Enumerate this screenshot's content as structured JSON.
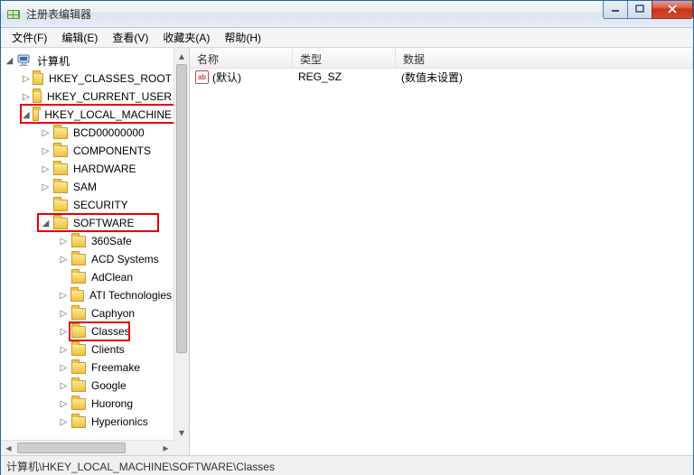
{
  "window": {
    "title": "注册表编辑器"
  },
  "menu": {
    "file": "文件(F)",
    "edit": "编辑(E)",
    "view": "查看(V)",
    "favorites": "收藏夹(A)",
    "help": "帮助(H)"
  },
  "tree": {
    "root": "计算机",
    "hkcr": "HKEY_CLASSES_ROOT",
    "hkcu": "HKEY_CURRENT_USER",
    "hklm": "HKEY_LOCAL_MACHINE",
    "hklm_children": {
      "bcd": "BCD00000000",
      "components": "COMPONENTS",
      "hardware": "HARDWARE",
      "sam": "SAM",
      "security": "SECURITY",
      "software": "SOFTWARE"
    },
    "software_children": {
      "s360": "360Safe",
      "acd": "ACD Systems",
      "adclean": "AdClean",
      "ati": "ATI Technologies",
      "caphyon": "Caphyon",
      "classes": "Classes",
      "clients": "Clients",
      "freemake": "Freemake",
      "google": "Google",
      "huorong": "Huorong",
      "hyperionics": "Hyperionics"
    }
  },
  "list": {
    "columns": {
      "name": "名称",
      "type": "类型",
      "data": "数据"
    },
    "rows": [
      {
        "name": "(默认)",
        "type": "REG_SZ",
        "data": "(数值未设置)"
      }
    ]
  },
  "statusbar": {
    "path": "计算机\\HKEY_LOCAL_MACHINE\\SOFTWARE\\Classes"
  }
}
